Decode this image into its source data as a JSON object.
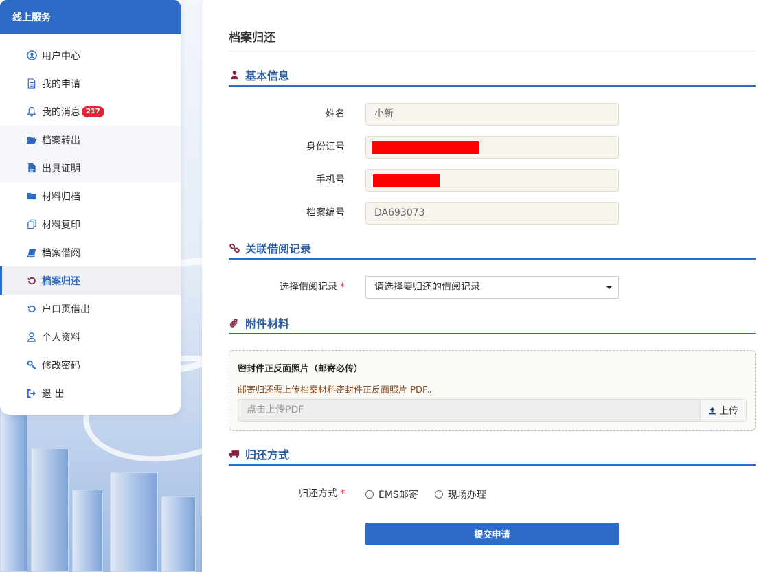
{
  "sidebar": {
    "title": "线上服务",
    "items": [
      {
        "label": "用户中心",
        "icon": "user-circle-icon"
      },
      {
        "label": "我的申请",
        "icon": "document-icon"
      },
      {
        "label": "我的消息",
        "icon": "bell-icon",
        "badge": "217"
      },
      {
        "label": "档案转出",
        "icon": "folder-open-icon"
      },
      {
        "label": "出具证明",
        "icon": "file-text-icon"
      },
      {
        "label": "材料归档",
        "icon": "folder-icon"
      },
      {
        "label": "材料复印",
        "icon": "copy-icon"
      },
      {
        "label": "档案借阅",
        "icon": "book-icon"
      },
      {
        "label": "档案归还",
        "icon": "undo-icon",
        "active": true
      },
      {
        "label": "户口页借出",
        "icon": "undo-icon"
      },
      {
        "label": "个人资料",
        "icon": "user-icon"
      },
      {
        "label": "修改密码",
        "icon": "key-icon"
      },
      {
        "label": "退 出",
        "icon": "sign-out-icon"
      }
    ]
  },
  "main": {
    "page_title": "档案归还",
    "basic_info": {
      "section_title": "基本信息",
      "name_label": "姓名",
      "name_value": "小新",
      "id_label": "身份证号",
      "phone_label": "手机号",
      "archive_no_label": "档案编号",
      "archive_no_value": "DA693073"
    },
    "borrow_record": {
      "section_title": "关联借阅记录",
      "select_label": "选择借阅记录",
      "required_mark": "*",
      "select_value": "请选择要归还的借阅记录"
    },
    "attachments": {
      "section_title": "附件材料",
      "box_title": "密封件正反面照片（邮寄必传）",
      "hint": "邮寄归还需上传档案材料密封件正反面照片 PDF。",
      "placeholder": "点击上传PDF",
      "upload_label": "上传"
    },
    "return_method": {
      "section_title": "归还方式",
      "label": "归还方式",
      "required_mark": "*",
      "options": [
        "EMS邮寄",
        "现场办理"
      ]
    },
    "submit_label": "提交申请"
  },
  "colors": {
    "primary": "#2d6bc7",
    "section_title": "#2d5d9f",
    "icon_accent": "#8b1f3a",
    "badge": "#e0283a",
    "redaction": "#ff0000"
  }
}
